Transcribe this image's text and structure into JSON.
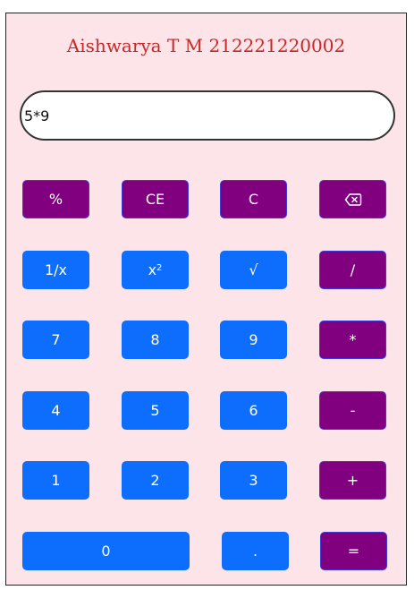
{
  "calculator": {
    "title": "Aishwarya T M 212221220002",
    "display_value": "5*9"
  },
  "buttons": {
    "percent": "%",
    "ce": "CE",
    "clear": "C",
    "backspace_icon": "backspace-icon",
    "reciprocal": "1/x",
    "square_base": "x",
    "square_exp": "2",
    "sqrt": "√",
    "divide": "/",
    "seven": "7",
    "eight": "8",
    "nine": "9",
    "multiply": "*",
    "four": "4",
    "five": "5",
    "six": "6",
    "minus": "-",
    "one": "1",
    "two": "2",
    "three": "3",
    "plus": "+",
    "zero": "0",
    "decimal": ".",
    "equals": "="
  },
  "colors": {
    "background": "#fce4e8",
    "title": "#c62828",
    "number_button": "#0d6efd",
    "operator_button": "#800080"
  }
}
